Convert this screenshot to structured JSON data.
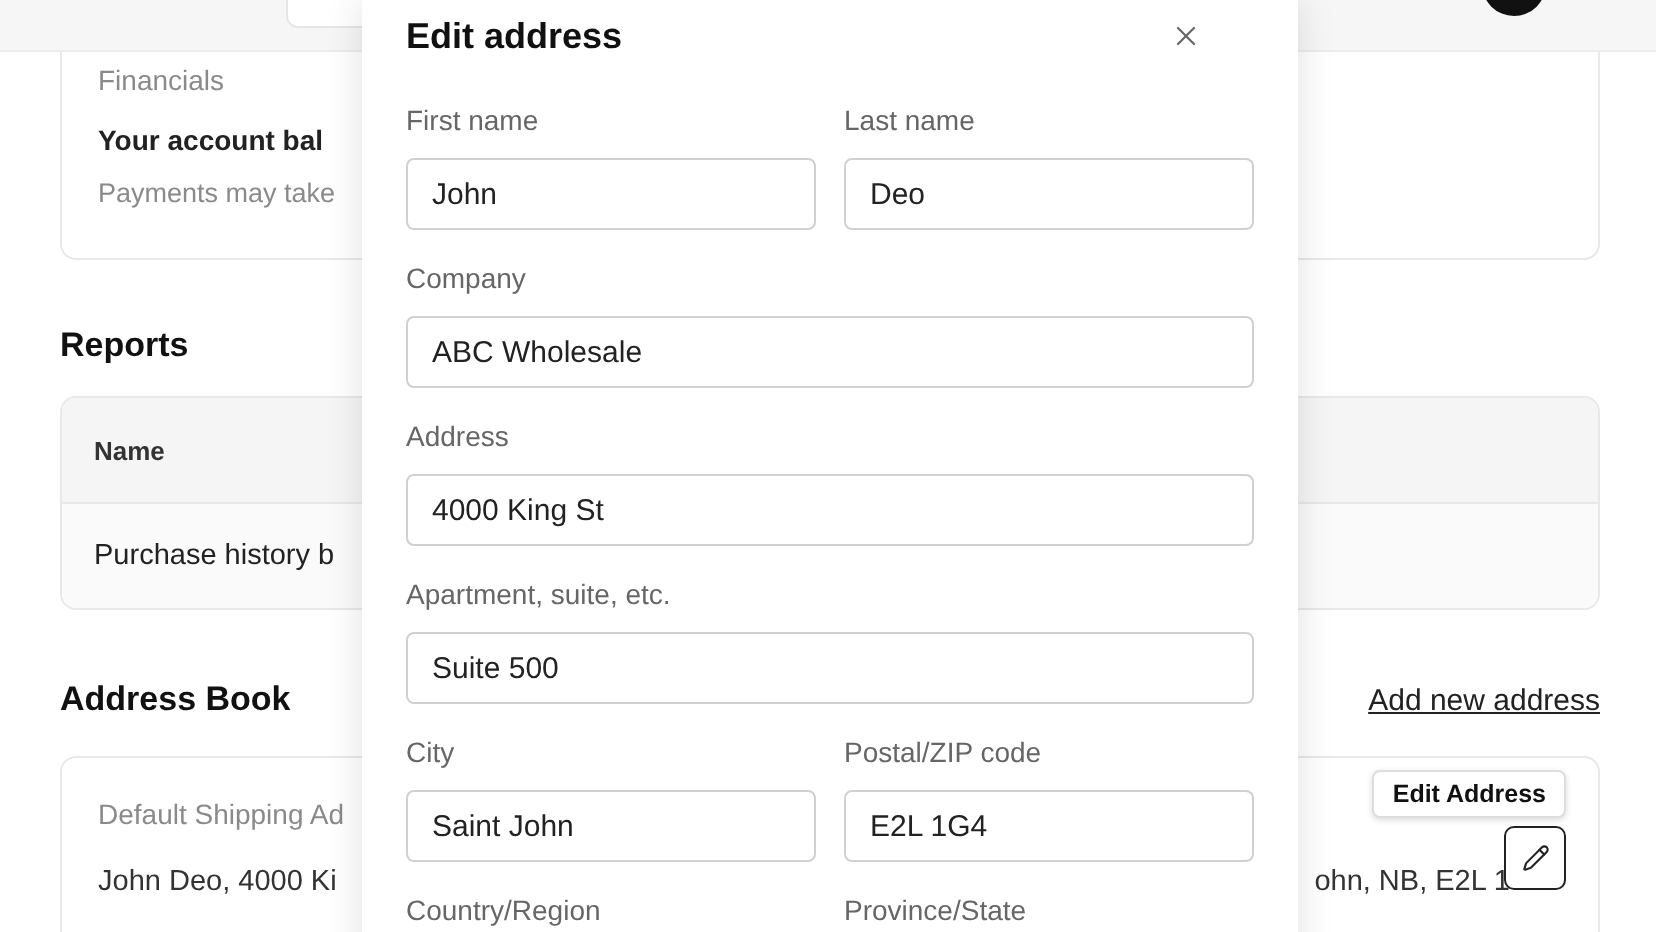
{
  "financials": {
    "title": "Financials",
    "balance": "Your account bal",
    "note": "Payments may take"
  },
  "reports": {
    "title": "Reports",
    "columns": [
      "Name"
    ],
    "rows": [
      [
        "Purchase history b"
      ]
    ]
  },
  "address_book": {
    "title": "Address Book",
    "add_link": "Add new address",
    "card": {
      "label": "Default Shipping Ad",
      "line_start": "John Deo, 4000 Ki",
      "line_end": "ohn, NB, E2L 1",
      "tooltip": "Edit Address"
    }
  },
  "modal": {
    "title": "Edit address",
    "fields": [
      {
        "label": "First name",
        "value": "John",
        "kind": "half"
      },
      {
        "label": "Last name",
        "value": "Deo",
        "kind": "half"
      },
      {
        "label": "Company",
        "value": "ABC Wholesale",
        "kind": "full"
      },
      {
        "label": "Address",
        "value": "4000 King St",
        "kind": "full"
      },
      {
        "label": "Apartment, suite, etc.",
        "value": "Suite 500",
        "kind": "full"
      },
      {
        "label": "City",
        "value": "Saint John",
        "kind": "half"
      },
      {
        "label": "Postal/ZIP code",
        "value": "E2L 1G4",
        "kind": "half"
      },
      {
        "label": "Country/Region",
        "kind": "half"
      },
      {
        "label": "Province/State",
        "kind": "half"
      }
    ]
  }
}
